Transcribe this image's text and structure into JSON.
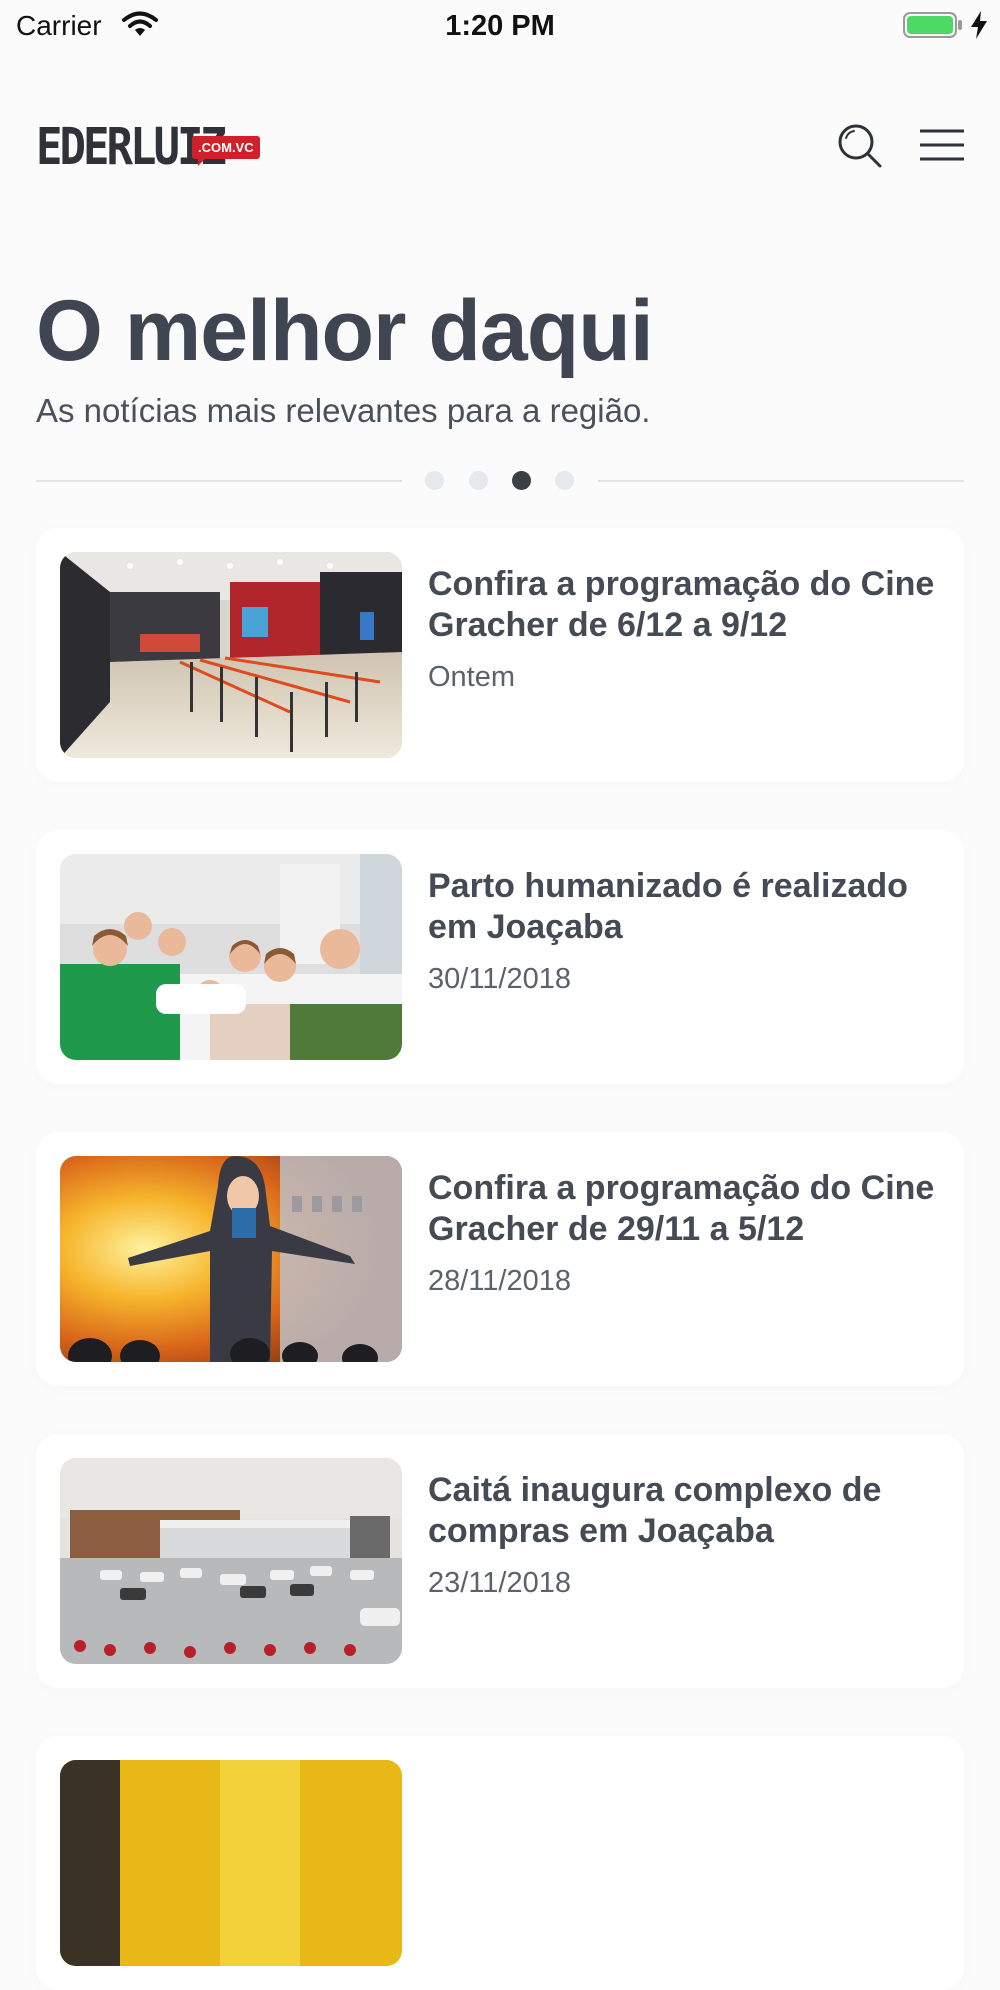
{
  "status_bar": {
    "carrier": "Carrier",
    "time": "1:20 PM",
    "battery_color": "#4cd964"
  },
  "header": {
    "logo_text": "EDERLUIZ",
    "logo_badge": ".COM.VC",
    "search_icon": "search-icon",
    "menu_icon": "hamburger-menu-icon"
  },
  "hero": {
    "title": "O melhor daqui",
    "subtitle": "As notícias mais relevantes para a região."
  },
  "pager": {
    "total": 4,
    "active_index": 2
  },
  "articles": [
    {
      "title": "Confira a programação do Cine Gracher de 6/12 a 9/12",
      "date": "Ontem"
    },
    {
      "title": "Parto humanizado é realizado em Joaçaba",
      "date": "30/11/2018"
    },
    {
      "title": "Confira a programação do Cine Gracher de 29/11 a 5/12",
      "date": "28/11/2018"
    },
    {
      "title": "Caitá inaugura complexo de compras em Joaçaba",
      "date": "23/11/2018"
    }
  ],
  "colors": {
    "brand_red": "#d0202a",
    "text_dark": "#3f4651",
    "background": "#fbfbfc"
  }
}
